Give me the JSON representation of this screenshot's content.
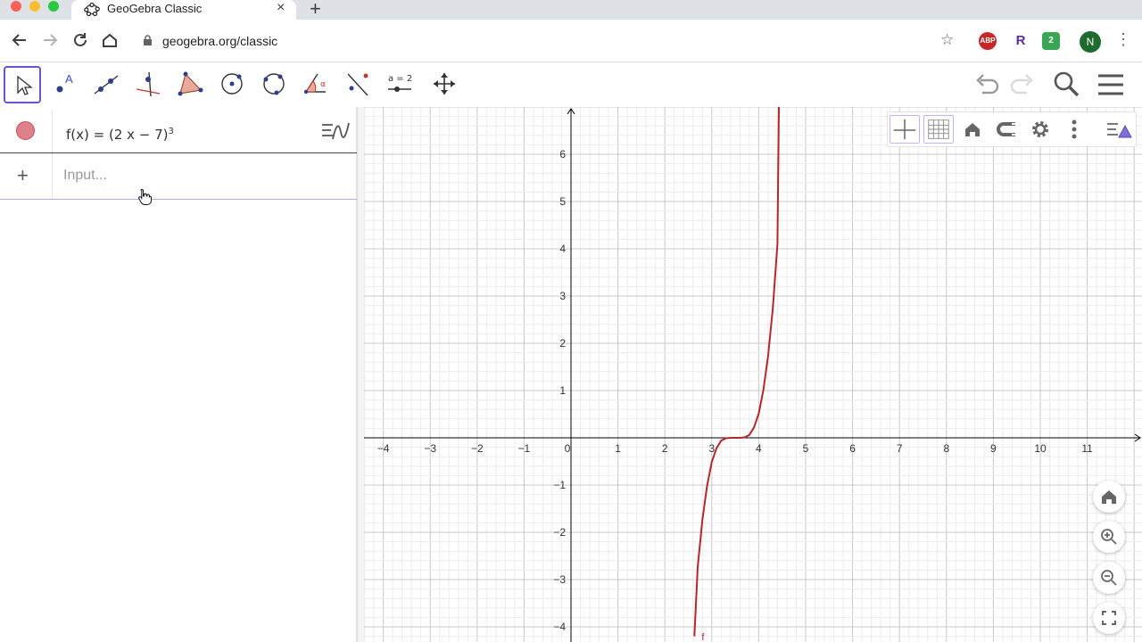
{
  "browser": {
    "tab_title": "GeoGebra Classic",
    "new_tab": "+",
    "url": "geogebra.org/classic",
    "extensions": [
      "ABP",
      "R",
      "2"
    ],
    "profile_initial": "N"
  },
  "toolbar": {
    "tools": [
      "move-tool",
      "point-tool",
      "line-tool",
      "perpendicular-line-tool",
      "polygon-tool",
      "circle-center-point-tool",
      "circle-three-points-tool",
      "angle-tool",
      "reflect-tool",
      "slider-tool",
      "move-graphics-view-tool"
    ],
    "slider_label": "a = 2",
    "right": [
      "undo-icon",
      "redo-icon",
      "search-icon",
      "menu-icon"
    ]
  },
  "algebra": {
    "function": {
      "base": "f(x)  =  (2 x − 7)",
      "exponent": "3",
      "color": "#e0808a"
    },
    "input": {
      "add": "+",
      "placeholder": "Input..."
    }
  },
  "graphics": {
    "style_bar": [
      "axes-toggle",
      "grid-toggle",
      "home-view",
      "point-capturing",
      "settings-icon",
      "more-icon",
      "graphics-menu-icon"
    ],
    "zoom_controls": [
      "home-icon",
      "zoom-in-icon",
      "zoom-out-icon",
      "fullscreen-icon"
    ]
  },
  "chart_data": {
    "type": "line",
    "title": "",
    "xlabel": "",
    "ylabel": "",
    "xlim": [
      -4.4,
      12.1
    ],
    "ylim": [
      -4.3,
      7.0
    ],
    "x_ticks": [
      -4,
      -3,
      -2,
      -1,
      0,
      1,
      2,
      3,
      4,
      5,
      6,
      7,
      8,
      9,
      10,
      11
    ],
    "y_ticks": [
      -4,
      -3,
      -2,
      -1,
      1,
      2,
      3,
      4,
      5,
      6
    ],
    "grid": true,
    "axis_color": "#000000",
    "series": [
      {
        "name": "f",
        "expression": "(2x-7)^3",
        "color": "#b5272d",
        "x": [
          2.63,
          2.7,
          2.8,
          2.9,
          3.0,
          3.1,
          3.2,
          3.3,
          3.4,
          3.5,
          3.6,
          3.7,
          3.8,
          3.9,
          4.0,
          4.1,
          4.2,
          4.3,
          4.4,
          4.43
        ],
        "y": [
          -4.2,
          -2.74,
          -1.73,
          -1.02,
          -0.51,
          -0.22,
          -0.06,
          -0.01,
          0.0,
          0.0,
          0.0,
          0.01,
          0.06,
          0.22,
          0.51,
          1.02,
          1.73,
          2.74,
          4.1,
          7.0
        ]
      }
    ]
  }
}
